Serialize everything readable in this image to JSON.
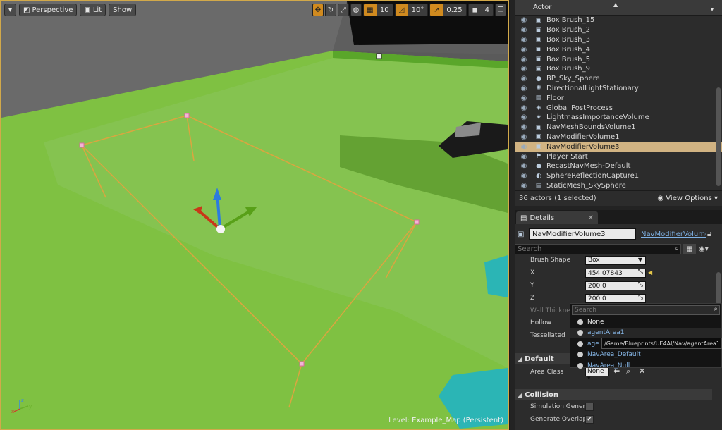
{
  "viewport": {
    "perspective_label": "Perspective",
    "lit_label": "Lit",
    "show_label": "Show",
    "grid_snap": "10",
    "rot_snap": "10°",
    "scale_snap": "0.25",
    "camera_speed": "4",
    "level_prefix": "Level:",
    "level_name": "Example_Map (Persistent)"
  },
  "outliner": {
    "column_header": "Actor",
    "actors": [
      {
        "label": "Box Brush_15",
        "icon": "brush-icon"
      },
      {
        "label": "Box Brush_2",
        "icon": "brush-icon"
      },
      {
        "label": "Box Brush_3",
        "icon": "brush-icon"
      },
      {
        "label": "Box Brush_4",
        "icon": "brush-icon"
      },
      {
        "label": "Box Brush_5",
        "icon": "brush-icon"
      },
      {
        "label": "Box Brush_9",
        "icon": "brush-icon"
      },
      {
        "label": "BP_Sky_Sphere",
        "icon": "sphere-icon"
      },
      {
        "label": "DirectionalLightStationary",
        "icon": "sun-icon"
      },
      {
        "label": "Floor",
        "icon": "mesh-icon"
      },
      {
        "label": "Global PostProcess",
        "icon": "postprocess-icon"
      },
      {
        "label": "LightmassImportanceVolume",
        "icon": "lightmass-icon"
      },
      {
        "label": "NavMeshBoundsVolume1",
        "icon": "volume-icon"
      },
      {
        "label": "NavModifierVolume1",
        "icon": "volume-icon"
      },
      {
        "label": "NavModifierVolume3",
        "icon": "volume-icon",
        "selected": true
      },
      {
        "label": "Player Start",
        "icon": "flag-icon"
      },
      {
        "label": "RecastNavMesh-Default",
        "icon": "sphere-icon"
      },
      {
        "label": "SphereReflectionCapture1",
        "icon": "reflection-icon"
      },
      {
        "label": "StaticMesh_SkySphere",
        "icon": "mesh-icon"
      }
    ],
    "count_text": "36 actors (1 selected)",
    "view_options": "View Options"
  },
  "details": {
    "tab_label": "Details",
    "actor_name": "NavModifierVolume3",
    "blueprint_link": "NavModifierVolume.h",
    "search_placeholder": "Search",
    "brush_shape_label": "Brush Shape",
    "brush_shape_value": "Box",
    "x_label": "X",
    "x_value": "454.07843",
    "y_label": "Y",
    "y_value": "200.0",
    "z_label": "Z",
    "z_value": "200.0",
    "wall_thickness_label": "Wall Thickness",
    "hollow_label": "Hollow",
    "tessellated_label": "Tessellated",
    "default_section": "Default",
    "area_class_label": "Area Class",
    "area_class_value": "None",
    "collision_section": "Collision",
    "sim_gen_label": "Simulation Generat",
    "gen_overlap_label": "Generate Overlap E"
  },
  "popup": {
    "search_placeholder": "Search",
    "items": [
      "None",
      "agentArea1",
      "age",
      "NavArea_Default",
      "NavArea_Null"
    ],
    "tooltip": "/Game/Blueprints/UE4AI/Nav/agentArea1"
  },
  "colors": {
    "selection": "#d1b382",
    "accent": "#d08a1f",
    "floor_green": "#7fc142",
    "link_blue": "#7fb2e6"
  }
}
